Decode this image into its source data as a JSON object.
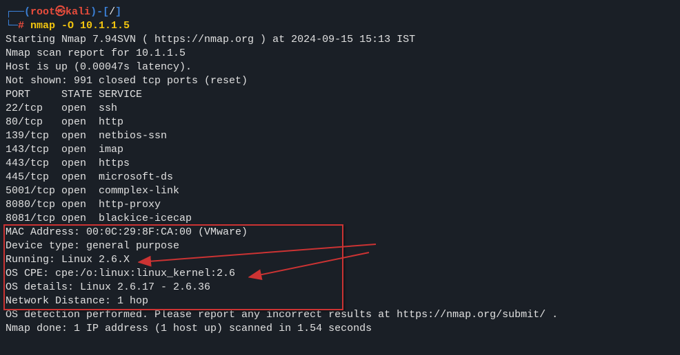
{
  "prompt": {
    "line1_open": "┌──(",
    "user": "root",
    "skull": "㉿",
    "host": "kali",
    "line1_close": ")-[",
    "path": "/",
    "line1_end": "]",
    "line2_open": "└─",
    "hash": "#",
    "command": " nmap -O 10.1.1.5"
  },
  "output": {
    "starting": "Starting Nmap 7.94SVN ( https://nmap.org ) at 2024-09-15 15:13 IST",
    "report": "Nmap scan report for 10.1.1.5",
    "host_up": "Host is up (0.00047s latency).",
    "not_shown": "Not shown: 991 closed tcp ports (reset)",
    "header": "PORT     STATE SERVICE",
    "ports": [
      "22/tcp   open  ssh",
      "80/tcp   open  http",
      "139/tcp  open  netbios-ssn",
      "143/tcp  open  imap",
      "443/tcp  open  https",
      "445/tcp  open  microsoft-ds",
      "5001/tcp open  commplex-link",
      "8080/tcp open  http-proxy",
      "8081/tcp open  blackice-icecap"
    ],
    "mac": "MAC Address: 00:0C:29:8F:CA:00 (VMware)",
    "device_type": "Device type: general purpose",
    "running": "Running: Linux 2.6.X",
    "os_cpe": "OS CPE: cpe:/o:linux:linux_kernel:2.6",
    "os_details": "OS details: Linux 2.6.17 - 2.6.36",
    "network_dist": "Network Distance: 1 hop",
    "blank": "",
    "detection": "OS detection performed. Please report any incorrect results at https://nmap.org/submit/ .",
    "done": "Nmap done: 1 IP address (1 host up) scanned in 1.54 seconds"
  }
}
